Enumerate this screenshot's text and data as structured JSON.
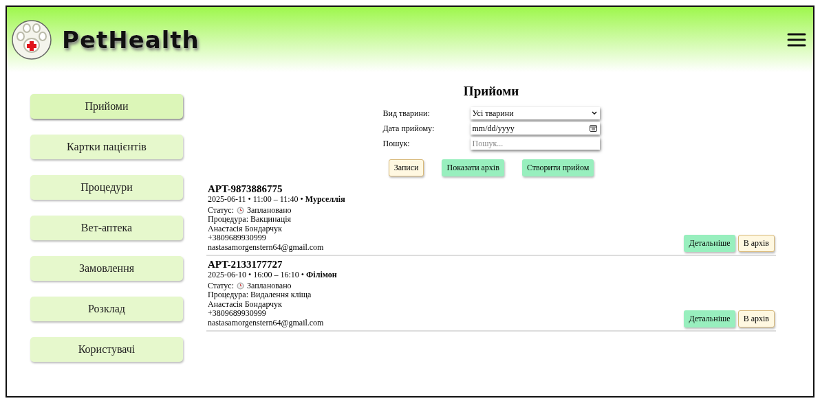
{
  "header": {
    "logo_text": "PetHealth"
  },
  "sidebar": {
    "items": [
      {
        "label": "Прийоми",
        "selected": true
      },
      {
        "label": "Картки пацієнтів",
        "selected": false
      },
      {
        "label": "Процедури",
        "selected": false
      },
      {
        "label": "Вет-аптека",
        "selected": false
      },
      {
        "label": "Замовлення",
        "selected": false
      },
      {
        "label": "Розклад",
        "selected": false
      },
      {
        "label": "Користувачі",
        "selected": false
      }
    ]
  },
  "page_title": "Прийоми",
  "filters": [
    {
      "kind": "select",
      "label": "Вид тварини:",
      "value": "Усі тварини"
    },
    {
      "kind": "date",
      "label": "Дата прийому:",
      "value": "mm/dd/yyyy"
    },
    {
      "kind": "text",
      "label": "Пошук:",
      "placeholder": "Пошук..."
    }
  ],
  "actions": [
    {
      "label": "Записи",
      "kind": "secondary"
    },
    {
      "label": "Показати архів",
      "kind": "primary"
    },
    {
      "label": "Створити прийом",
      "kind": "primary"
    }
  ],
  "appointments": [
    {
      "id": "APT-9873886775",
      "when": "2025-06-11 • 11:00 – 11:40 •",
      "pet": "Мурселлія",
      "status_label": "Статус:",
      "status": "Заплановано",
      "procedure": "Процедура: Вакцинація",
      "owner": "Анастасія Бондарчук",
      "phone": "+3809689930999",
      "email": "nastasamorgenstern64@gmail.com",
      "details_button": "Детальніше",
      "archive_button": "В архів"
    },
    {
      "id": "APT-2133177727",
      "when": "2025-06-10 • 16:00 – 16:10 •",
      "pet": "Філімон",
      "status_label": "Статус:",
      "status": "Заплановано",
      "procedure": "Процедура: Видалення кліща",
      "owner": "Анастасія Бондарчук",
      "phone": "+3809689930999",
      "email": "nastasamorgenstern64@gmail.com",
      "details_button": "Детальніше",
      "archive_button": "В архів"
    }
  ]
}
